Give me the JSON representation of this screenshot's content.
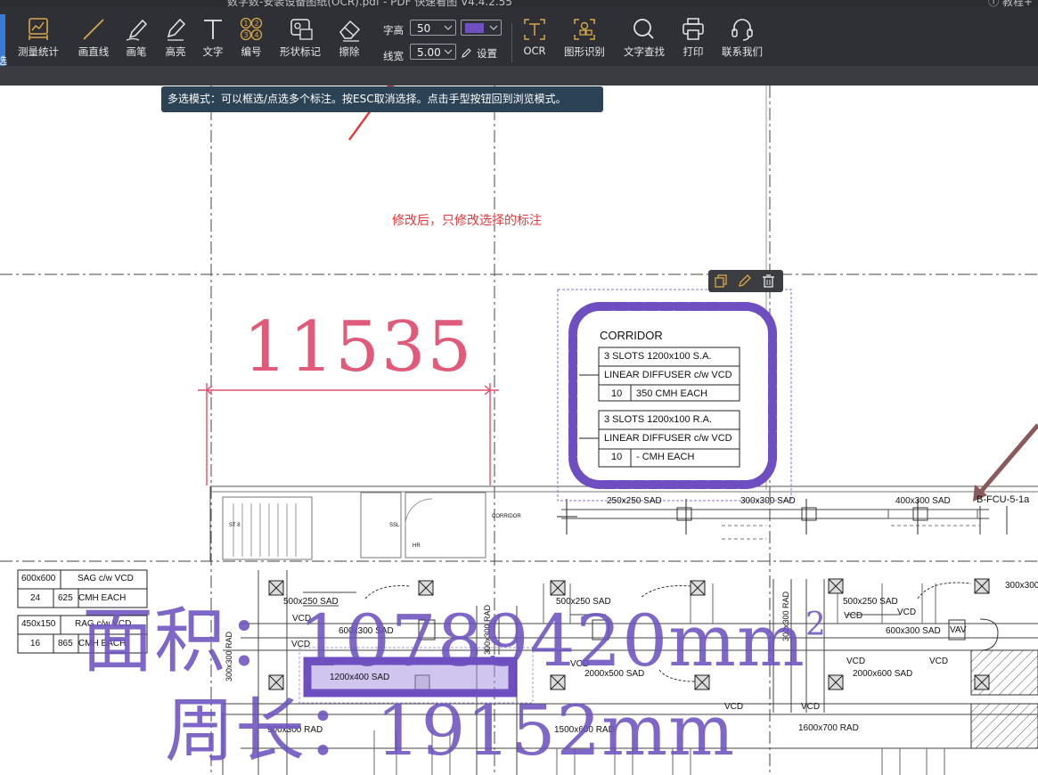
{
  "window": {
    "title": "数字数-安装设备图纸(OCR).pdf - PDF 快速看图 V4.4.2.55",
    "right_text": "ⓘ 教程+"
  },
  "toolbar": {
    "left_edge_label": "选",
    "tools": [
      {
        "id": "measure-stats",
        "label": "测量统计",
        "icon": "measure-stats-icon"
      },
      {
        "id": "line",
        "label": "画直线",
        "icon": "line-icon"
      },
      {
        "id": "pen",
        "label": "画笔",
        "icon": "pen-icon"
      },
      {
        "id": "highlight",
        "label": "高亮",
        "icon": "highlighter-icon"
      },
      {
        "id": "text",
        "label": "文字",
        "icon": "text-icon"
      },
      {
        "id": "number",
        "label": "编号",
        "icon": "numbering-icon"
      },
      {
        "id": "shape-mark",
        "label": "形状标记",
        "icon": "shape-mark-icon"
      },
      {
        "id": "erase",
        "label": "擦除",
        "icon": "eraser-icon"
      }
    ],
    "font_size_label": "字高",
    "font_size_value": "50",
    "line_width_label": "线宽",
    "line_width_value": "5.00",
    "color_value": "#6f4ec2",
    "settings_label": "设置",
    "right_tools": [
      {
        "id": "ocr",
        "label": "OCR",
        "icon": "ocr-icon"
      },
      {
        "id": "shape-recognize",
        "label": "图形识别",
        "icon": "shape-recognize-icon"
      },
      {
        "id": "text-search",
        "label": "文字查找",
        "icon": "search-icon"
      },
      {
        "id": "print",
        "label": "打印",
        "icon": "printer-icon"
      },
      {
        "id": "contact",
        "label": "联系我们",
        "icon": "headset-icon"
      }
    ]
  },
  "tooltip": "多选模式：可以框选/点选多个标注。按ESC取消选择。点击手型按钮回到浏览模式。",
  "annotations": {
    "red_note": "修改后，只修改选择的标注",
    "dimension_value": "11535",
    "area_label": "面积：10789420mm",
    "area_superscript": "2",
    "perimeter_label": "周长：19152mm"
  },
  "corridor_box": {
    "title": "CORRIDOR",
    "row1": "3 SLOTS 1200x100 S.A.",
    "row2": "LINEAR DIFFUSER c/w VCD",
    "row3_num": "10",
    "row3_text": "350 CMH EACH",
    "row4": "3 SLOTS 1200x100 R.A.",
    "row5": "LINEAR DIFFUSER c/w VCD",
    "row6_num": "10",
    "row6_text": "- CMH EACH"
  },
  "legend": {
    "r1a": "600x600",
    "r1b": "SAG c/w VCD",
    "r2a": "24",
    "r2b": "625",
    "r2c": "CMH EACH",
    "r3a": "450x150",
    "r3b": "RAG c/w VCD",
    "r4a": "16",
    "r4b": "865",
    "r4c": "CMH EACH"
  },
  "drawing_labels": {
    "duct1": "250x250 SAD",
    "duct2": "300x300 SAD",
    "duct3": "400x300 SAD",
    "fcu": "B-FCU-5-1a",
    "st": "ST 8",
    "ssl": "SSL",
    "corridor_small": "CORRIDOR",
    "hr": "HR",
    "sad500a": "500x250 SAD",
    "sad500b": "500x250 SAD",
    "sad500c": "500x250 SAD",
    "sad600a": "600x300 SAD",
    "sad600b": "600x300 SAD",
    "sad1200": "1200x400 SAD",
    "sad2000a": "2000x500 SAD",
    "sad2000b": "2000x600 SAD",
    "rad900": "900x300 RAD",
    "rad1500": "1500x600 RAD",
    "rad1600": "1600x700 RAD",
    "rad300a": "300x300 RAD",
    "rad300b": "300x300 RAD",
    "rad300c": "300x300 RAD",
    "sad300r": "300x300",
    "vcd": "VCD",
    "vav": "VAV"
  }
}
